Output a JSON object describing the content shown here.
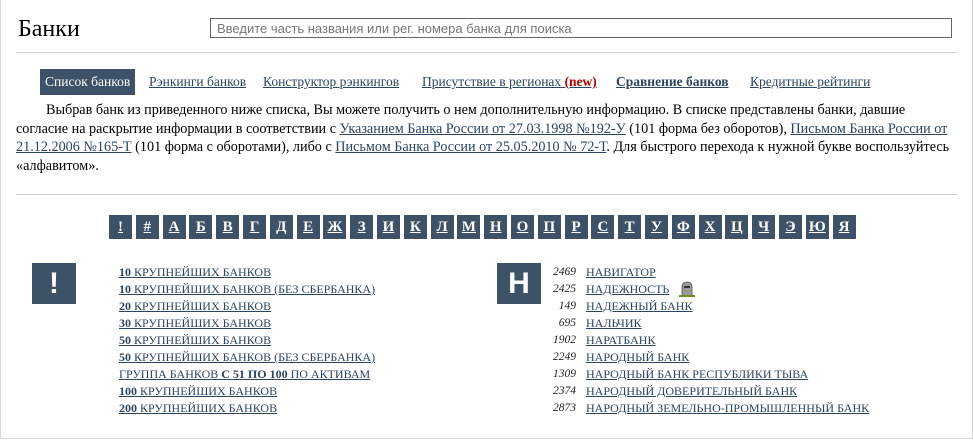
{
  "header": {
    "title": "Банки",
    "search_placeholder": "Введите часть названия или рег. номера банка для поиска"
  },
  "tabs": [
    {
      "label": "Список банков",
      "active": true
    },
    {
      "label": "Рэнкинги банков"
    },
    {
      "label": "Конструктор рэнкингов"
    },
    {
      "label": "Присутствие в регионах",
      "badge": "(new)"
    },
    {
      "label": "Сравнение банков",
      "bold": true
    },
    {
      "label": "Кредитные рейтинги"
    }
  ],
  "intro": {
    "part1": "Выбрав банк из приведенного ниже списка, Вы можете получить о нем дополнительную информацию. В списке представлены банки, давшие согласие на раскрытие информации в соответствии с ",
    "link1": "Указанием Банка России от 27.03.1998 №192-У",
    "part2": " (101 форма без оборотов), ",
    "link2": "Письмом Банка России от 21.12.2006 №165-Т",
    "part3": " (101 форма с оборотами), либо с ",
    "link3": "Письмом Банка России от 25.05.2010 № 72-Т",
    "part4": ". Для быстрого перехода к нужной букве воспользуйтесь «алфавитом»."
  },
  "alphabet": [
    "!",
    "#",
    "А",
    "Б",
    "В",
    "Г",
    "Д",
    "Е",
    "Ж",
    "З",
    "И",
    "К",
    "Л",
    "М",
    "Н",
    "О",
    "П",
    "Р",
    "С",
    "Т",
    "У",
    "Ф",
    "Х",
    "Ц",
    "Ч",
    "Э",
    "Ю",
    "Я"
  ],
  "section_excl": {
    "letter": "!",
    "items": [
      {
        "bold": "10",
        "text": " КРУПНЕЙШИХ БАНКОВ"
      },
      {
        "bold": "10",
        "text": " КРУПНЕЙШИХ БАНКОВ (БЕЗ СБЕРБАНКА)"
      },
      {
        "bold": "20",
        "text": " КРУПНЕЙШИХ БАНКОВ"
      },
      {
        "bold": "30",
        "text": " КРУПНЕЙШИХ БАНКОВ"
      },
      {
        "bold": "50",
        "text": " КРУПНЕЙШИХ БАНКОВ"
      },
      {
        "bold": "50",
        "text": " КРУПНЕЙШИХ БАНКОВ (БЕЗ СБЕРБАНКА)"
      },
      {
        "pre": "ГРУППА БАНКОВ ",
        "bold": "С 51 ПО 100",
        "text": " ПО АКТИВАМ"
      },
      {
        "bold": "100",
        "text": " КРУПНЕЙШИХ БАНКОВ"
      },
      {
        "bold": "200",
        "text": " КРУПНЕЙШИХ БАНКОВ"
      }
    ]
  },
  "section_n": {
    "letter": "Н",
    "items": [
      {
        "num": "2469",
        "name": "НАВИГАТОР"
      },
      {
        "num": "2425",
        "name": "НАДЕЖНОСТЬ",
        "icon": "rip-tombstone-icon"
      },
      {
        "num": "149",
        "name": "НАДЕЖНЫЙ БАНК"
      },
      {
        "num": "695",
        "name": "НАЛЬЧИК"
      },
      {
        "num": "1902",
        "name": "НАРАТБАНК"
      },
      {
        "num": "2249",
        "name": "НАРОДНЫЙ БАНК"
      },
      {
        "num": "1309",
        "name": "НАРОДНЫЙ БАНК РЕСПУБЛИКИ ТЫВА"
      },
      {
        "num": "2374",
        "name": "НАРОДНЫЙ ДОВЕРИТЕЛЬНЫЙ БАНК"
      },
      {
        "num": "2873",
        "name": "НАРОДНЫЙ ЗЕМЕЛЬНО-ПРОМЫШЛЕННЫЙ БАНК"
      }
    ]
  }
}
